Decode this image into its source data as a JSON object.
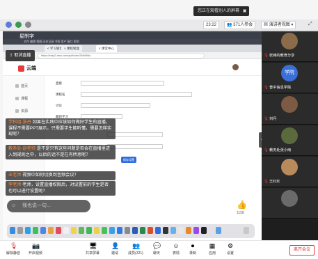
{
  "banner": {
    "text": "您正在观看别人的屏幕",
    "icon": "screen-icon"
  },
  "topbar": {
    "time": "23:22",
    "viewers": "371人参会",
    "view_mode": "演讲者视图"
  },
  "shared_screen": {
    "app_name": "星制字",
    "menu_text": "文件  编辑  视图  历史记录  书签  用户  窗口  帮助",
    "tabs": [
      "< 学习管理",
      "× 课程管理",
      "× 课堂中心"
    ],
    "url": "https://easy2.amu.com/api/index/3b9d0f4e",
    "site_name": "云端",
    "live_badge": "取消直播",
    "sidebar_items": [
      "首页",
      "课程",
      "资源",
      "班级",
      "设置"
    ],
    "form_rows": [
      {
        "label": "直接",
        "value": ""
      },
      {
        "label": "课程名",
        "value": ""
      },
      {
        "label": "讨论",
        "value": ""
      },
      {
        "label": "最新学习",
        "value": ""
      }
    ],
    "action_button": "保存设置"
  },
  "chat": {
    "messages": [
      {
        "name": "学科组-张丹",
        "text": "如果在实践中应该如何做好学生的直播，课程不需要PPT展示，只需要学生能听懂，需要怎样实现呢？"
      },
      {
        "name": "教务处-赵老师",
        "text": "是不是只有这些问题是否会在直播里进入到规则之中，以后的话不是在有所思呢？"
      },
      {
        "name": "王老师",
        "text": "视频中如何切换到音频会议？"
      },
      {
        "name": "李老师",
        "text": "老师，设置直播权限后，对设置前的学生是否也可以进行设置呢？"
      }
    ],
    "input_placeholder": "我也说一句..."
  },
  "like_count": "1158",
  "participants": [
    {
      "name": "张峰的教育分享",
      "color": "#8b6b4a"
    },
    {
      "name": "普中信息学院",
      "color": "#3a6fd8",
      "label": "学院"
    },
    {
      "name": "刘丹",
      "color": "#7d5a44"
    },
    {
      "name": "教务处张小雨",
      "color": "#5b6a3c"
    },
    {
      "name": "王红红",
      "color": "#b88a5c"
    },
    {
      "name": "",
      "color": "#6a6a6a"
    }
  ],
  "toolbar": {
    "mute": "解除静音",
    "video": "开启视频",
    "share": "共享屏幕",
    "invite": "邀请",
    "members": "成员(321)",
    "chat": "聊天",
    "reactions": "表情",
    "record": "录制",
    "apps": "应用",
    "settings": "设置",
    "leave": "离开会议"
  },
  "colors": {
    "accent": "#e23c3c",
    "panel_bg": "#1e1e1e",
    "link": "#2d6cdf"
  }
}
